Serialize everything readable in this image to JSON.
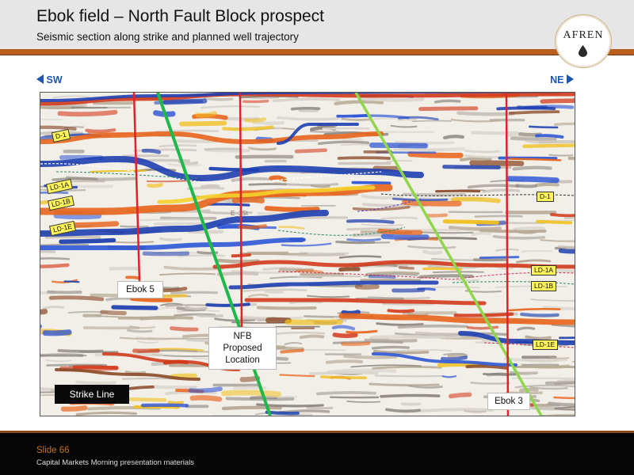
{
  "header": {
    "title": "Ebok field – North Fault Block prospect",
    "subtitle": "Seismic section along strike and planned well trajectory",
    "logo_text": "AFREN"
  },
  "section": {
    "left_direction": "SW",
    "right_direction": "NE",
    "horizon_tags_left": [
      "D-1",
      "LD-1A",
      "LD-1B",
      "LD-1E"
    ],
    "horizon_tags_right": [
      "D-1",
      "LD-1A",
      "LD-1B",
      "LD-1E"
    ],
    "well_ebok5": "Ebok 5",
    "well_nfb": [
      "NFB",
      "Proposed",
      "Location"
    ],
    "well_ebok3": "Ebok 3",
    "strike_label": "Strike Line",
    "faint_label": "E_1St"
  },
  "footer": {
    "slide_number": "Slide 66",
    "caption": "Capital Markets Morning presentation materials"
  },
  "colors": {
    "accent": "#b85d1e",
    "arrow_blue": "#1f55b4",
    "tag_yellow": "#fff35a",
    "well_red": "#e0202a",
    "fault_green": "#1fb84a",
    "fault_lightgreen": "#8fd64a"
  }
}
